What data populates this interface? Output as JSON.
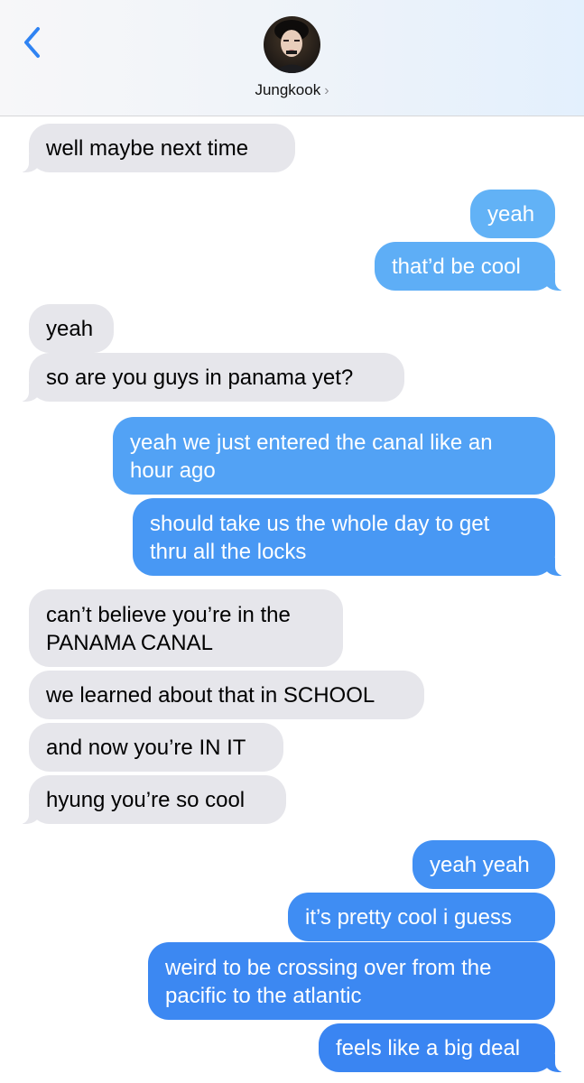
{
  "header": {
    "back_icon": "chevron-left-icon",
    "contact_name": "Jungkook",
    "disclosure": "›",
    "avatar_icon": "contact-photo"
  },
  "colors": {
    "accent": "#2f83f3",
    "incoming_bubble": "#e6e6eb",
    "outgoing_top": "#64b3f6",
    "outgoing_bottom": "#3a82f2"
  },
  "messages": [
    {
      "from": "them",
      "text": "well maybe next time"
    },
    {
      "from": "me",
      "text": "yeah"
    },
    {
      "from": "me",
      "text": "that’d be cool"
    },
    {
      "from": "them",
      "text": "yeah"
    },
    {
      "from": "them",
      "text": "so are you guys in panama yet?"
    },
    {
      "from": "me",
      "lines": [
        "yeah we just entered the canal like an",
        "hour ago"
      ]
    },
    {
      "from": "me",
      "lines": [
        "should take us the whole day to get",
        "thru all the locks"
      ]
    },
    {
      "from": "them",
      "lines": [
        "can’t believe you’re in the",
        "PANAMA CANAL"
      ]
    },
    {
      "from": "them",
      "text": "we learned about that in SCHOOL"
    },
    {
      "from": "them",
      "text": "and now you’re IN IT"
    },
    {
      "from": "them",
      "text": "hyung you’re so cool"
    },
    {
      "from": "me",
      "text": "yeah yeah"
    },
    {
      "from": "me",
      "text": "it’s pretty cool i guess"
    },
    {
      "from": "me",
      "lines": [
        "weird to be crossing over from the",
        "pacific to the atlantic"
      ]
    },
    {
      "from": "me",
      "text": "feels like a big deal"
    }
  ]
}
